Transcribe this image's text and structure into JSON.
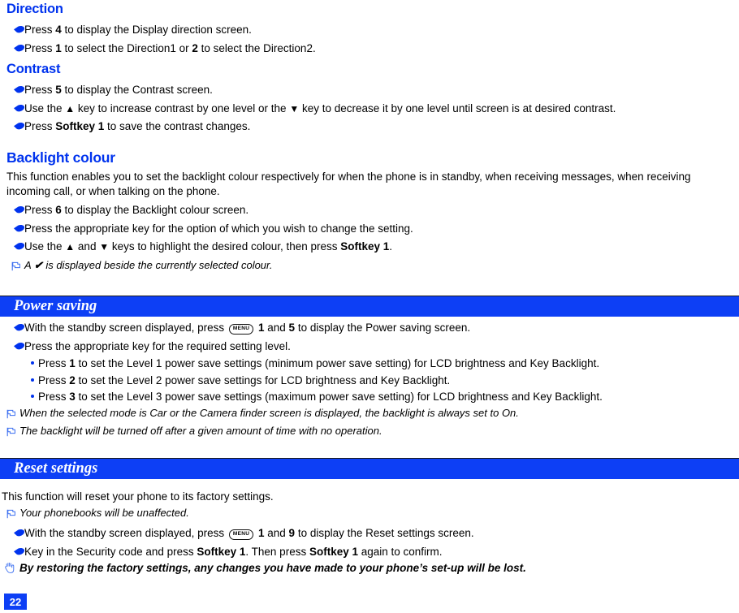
{
  "colors": {
    "accent_blue": "#0033ee",
    "band_blue": "#0d3ff5",
    "text": "#000000"
  },
  "sections": [
    {
      "id": "direction",
      "heading": "Direction",
      "items": [
        {
          "type": "hand",
          "parts": [
            {
              "t": "Press ",
              "b": false
            },
            {
              "t": "4",
              "b": true
            },
            {
              "t": " to display the Display direction screen.",
              "b": false
            }
          ]
        },
        {
          "type": "hand",
          "parts": [
            {
              "t": "Press ",
              "b": false
            },
            {
              "t": "1",
              "b": true
            },
            {
              "t": " to select the Direction1 or ",
              "b": false
            },
            {
              "t": "2",
              "b": true
            },
            {
              "t": " to select the Direction2.",
              "b": false
            }
          ]
        }
      ]
    },
    {
      "id": "contrast",
      "heading": "Contrast",
      "items": [
        {
          "type": "hand",
          "parts": [
            {
              "t": "Press ",
              "b": false
            },
            {
              "t": "5",
              "b": true
            },
            {
              "t": " to display the Contrast screen.",
              "b": false
            }
          ]
        },
        {
          "type": "hand",
          "parts": [
            {
              "t": "Use the ",
              "b": false
            },
            {
              "t": "▲",
              "b": false
            },
            {
              "t": " key to increase contrast by one level or the ",
              "b": false
            },
            {
              "t": "▼",
              "b": false
            },
            {
              "t": " key to decrease it by one level until screen is at desired contrast.",
              "b": false
            }
          ]
        },
        {
          "type": "hand",
          "parts": [
            {
              "t": "Press ",
              "b": false
            },
            {
              "t": "Softkey 1",
              "b": true
            },
            {
              "t": " to save the contrast changes.",
              "b": false
            }
          ]
        }
      ]
    },
    {
      "id": "backlight-colour",
      "heading": "Backlight colour",
      "paragraph": "This function enables you to set the backlight colour respectively for when the phone is in standby, when receiving messages, when receiving incoming call, or when talking on the phone.",
      "items": [
        {
          "type": "hand",
          "parts": [
            {
              "t": "Press ",
              "b": false
            },
            {
              "t": "6",
              "b": true
            },
            {
              "t": " to display the Backlight colour screen.",
              "b": false
            }
          ]
        },
        {
          "type": "hand",
          "parts": [
            {
              "t": "Press the appropriate key for the option of which you wish to change the setting.",
              "b": false
            }
          ]
        },
        {
          "type": "hand",
          "parts": [
            {
              "t": "Use the ",
              "b": false
            },
            {
              "t": "▲",
              "b": false
            },
            {
              "t": " and ",
              "b": false
            },
            {
              "t": "▼",
              "b": false
            },
            {
              "t": " keys to highlight the desired colour, then press ",
              "b": false
            },
            {
              "t": "Softkey 1",
              "b": true
            },
            {
              "t": ".",
              "b": false
            }
          ]
        },
        {
          "type": "note",
          "parts": [
            {
              "t": "A ",
              "b": false
            },
            {
              "t": "✔",
              "b": true
            },
            {
              "t": " is displayed beside the currently selected colour.",
              "b": false
            }
          ]
        }
      ]
    }
  ],
  "band_sections": [
    {
      "id": "power-saving",
      "title": "Power saving",
      "items": [
        {
          "type": "hand",
          "parts": [
            {
              "t": "With the standby screen displayed, press ",
              "b": false
            },
            {
              "t": "MENU",
              "key": true
            },
            {
              "t": " ",
              "b": false
            },
            {
              "t": "1",
              "b": true
            },
            {
              "t": " and ",
              "b": false
            },
            {
              "t": "5",
              "b": true
            },
            {
              "t": " to display the Power saving screen.",
              "b": false
            }
          ]
        },
        {
          "type": "hand",
          "parts": [
            {
              "t": "Press the appropriate key for the required setting level.",
              "b": false
            }
          ]
        },
        {
          "type": "sub",
          "parts": [
            {
              "t": "Press ",
              "b": false
            },
            {
              "t": "1",
              "b": true
            },
            {
              "t": " to set the Level 1 power save settings (minimum power save setting) for LCD brightness and Key Backlight.",
              "b": false
            }
          ]
        },
        {
          "type": "sub",
          "parts": [
            {
              "t": "Press ",
              "b": false
            },
            {
              "t": "2",
              "b": true
            },
            {
              "t": " to set the Level 2 power save settings for LCD brightness and Key Backlight.",
              "b": false
            }
          ]
        },
        {
          "type": "sub",
          "parts": [
            {
              "t": "Press ",
              "b": false
            },
            {
              "t": "3",
              "b": true
            },
            {
              "t": " to set the Level 3 power save settings (maximum power save setting) for LCD brightness and Key Backlight.",
              "b": false
            }
          ]
        },
        {
          "type": "note",
          "parts": [
            {
              "t": "When the selected mode is Car or the Camera finder screen is displayed, the backlight is always set to On.",
              "b": false
            }
          ]
        },
        {
          "type": "note",
          "parts": [
            {
              "t": "The backlight will be turned off after a given amount of time with no operation.",
              "b": false
            }
          ]
        }
      ]
    },
    {
      "id": "reset-settings",
      "title": "Reset settings",
      "items": [
        {
          "type": "para",
          "parts": [
            {
              "t": "This function will reset your phone to its factory settings.",
              "b": false
            }
          ]
        },
        {
          "type": "note",
          "parts": [
            {
              "t": "Your phonebooks will be unaffected.",
              "b": false
            }
          ]
        },
        {
          "type": "hand",
          "parts": [
            {
              "t": "With the standby screen displayed, press ",
              "b": false
            },
            {
              "t": "MENU",
              "key": true
            },
            {
              "t": " ",
              "b": false
            },
            {
              "t": "1",
              "b": true
            },
            {
              "t": " and ",
              "b": false
            },
            {
              "t": "9",
              "b": true
            },
            {
              "t": " to display the Reset settings screen.",
              "b": false
            }
          ]
        },
        {
          "type": "hand",
          "parts": [
            {
              "t": "Key in the Security code and press ",
              "b": false
            },
            {
              "t": "Softkey 1",
              "b": true
            },
            {
              "t": ". Then press ",
              "b": false
            },
            {
              "t": "Softkey 1",
              "b": true
            },
            {
              "t": " again to confirm.",
              "b": false
            }
          ]
        },
        {
          "type": "warn",
          "parts": [
            {
              "t": "By restoring the factory settings, any changes you have made to your phone’s set-up will be lost.",
              "b": true
            }
          ]
        }
      ]
    }
  ],
  "footer": {
    "page_number": "22"
  }
}
